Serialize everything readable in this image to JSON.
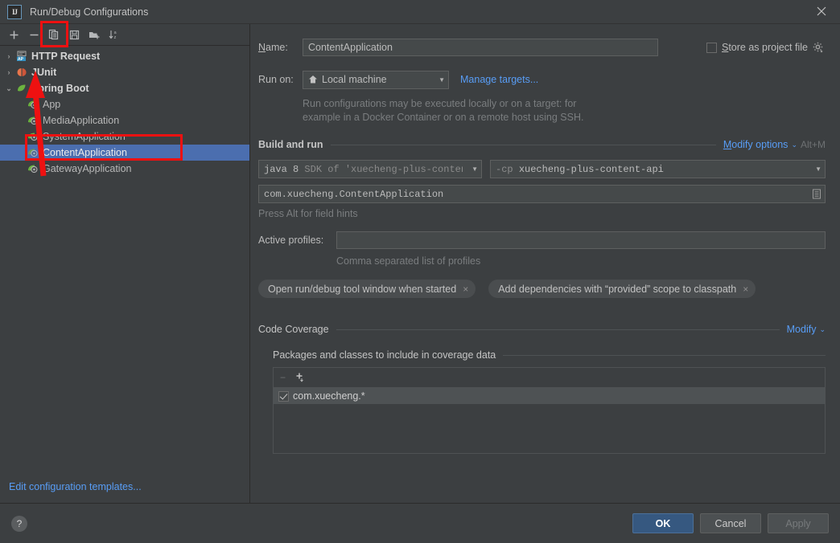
{
  "window": {
    "title": "Run/Debug Configurations",
    "app_icon": "intellij-idea-icon",
    "close_label": "×"
  },
  "tree_toolbar": {
    "buttons": [
      {
        "name": "add-configuration-button",
        "glyph": "plus"
      },
      {
        "name": "remove-configuration-button",
        "glyph": "minus"
      },
      {
        "name": "copy-configuration-button",
        "glyph": "copy"
      },
      {
        "name": "save-configuration-button",
        "glyph": "save"
      },
      {
        "name": "move-into-folder-button",
        "glyph": "folder-add"
      },
      {
        "name": "sort-configurations-button",
        "glyph": "sort-az"
      }
    ]
  },
  "tree": {
    "items": [
      {
        "label": "HTTP Request",
        "level": 0,
        "expanded": false,
        "arrow": "›",
        "icon": "http-request-icon",
        "selected": false
      },
      {
        "label": "JUnit",
        "level": 0,
        "expanded": false,
        "arrow": "›",
        "icon": "junit-icon",
        "selected": false
      },
      {
        "label": "Spring Boot",
        "level": 0,
        "expanded": true,
        "arrow": "⌄",
        "icon": "spring-boot-icon",
        "selected": false
      },
      {
        "label": "App",
        "level": 1,
        "icon": "spring-config-icon",
        "selected": false
      },
      {
        "label": "MediaApplication",
        "level": 1,
        "icon": "spring-config-icon",
        "selected": false
      },
      {
        "label": "SystemApplication",
        "level": 1,
        "icon": "spring-config-icon",
        "selected": false
      },
      {
        "label": "ContentApplication",
        "level": 1,
        "icon": "spring-config-icon",
        "selected": true
      },
      {
        "label": "GatewayApplication",
        "level": 1,
        "icon": "spring-config-icon",
        "selected": false
      }
    ],
    "edit_templates_link": "Edit configuration templates..."
  },
  "form": {
    "name_label": "Name:",
    "name_value": "ContentApplication",
    "name_placeholder": "",
    "store_as_project_file_label": "Store as project file",
    "store_as_project_file_checked": false,
    "store_gear_icon": "gear-icon",
    "run_on_label": "Run on:",
    "run_on_value": "Local machine",
    "run_on_icon": "local-machine-icon",
    "manage_targets_link": "Manage targets...",
    "target_hint_line1": "Run configurations may be executed locally or on a target: for",
    "target_hint_line2": "example in a Docker Container or on a remote host using SSH."
  },
  "build_and_run": {
    "section_title": "Build and run",
    "modify_options_link": "Modify options",
    "modify_options_shortcut": "Alt+M",
    "sdk_prefix": "java 8",
    "sdk_suffix": " SDK of 'xuecheng-plus-content",
    "classpath_prefix": "-cp",
    "classpath_value": "xuecheng-plus-content-api",
    "main_class_value": "com.xuecheng.ContentApplication",
    "main_class_browse_icon": "browse-class-icon",
    "field_hints": "Press Alt for field hints",
    "active_profiles_label": "Active profiles:",
    "active_profiles_value": "",
    "active_profiles_placeholder": "",
    "profiles_hint": "Comma separated list of profiles",
    "chips": [
      {
        "label": "Open run/debug tool window when started",
        "close": "×"
      },
      {
        "label": "Add dependencies with “provided” scope to classpath",
        "close": "×"
      }
    ]
  },
  "code_coverage": {
    "section_title": "Code Coverage",
    "modify_link": "Modify",
    "sub_title": "Packages and classes to include in coverage data",
    "toolbar": [
      {
        "name": "remove-package-button",
        "glyph": "−"
      },
      {
        "name": "add-package-button",
        "glyph": "+"
      }
    ],
    "rows": [
      {
        "label": "com.xuecheng.*",
        "checked": true
      }
    ]
  },
  "footer": {
    "help_label": "?",
    "ok_label": "OK",
    "cancel_label": "Cancel",
    "apply_label": "Apply",
    "apply_enabled": false
  },
  "annotations": {
    "highlight_color": "#ee1111",
    "boxes": [
      "copy-configuration-button",
      "tree-item-contentapplication"
    ],
    "arrow": "arrow-from-contentapplication-to-copy-button"
  }
}
